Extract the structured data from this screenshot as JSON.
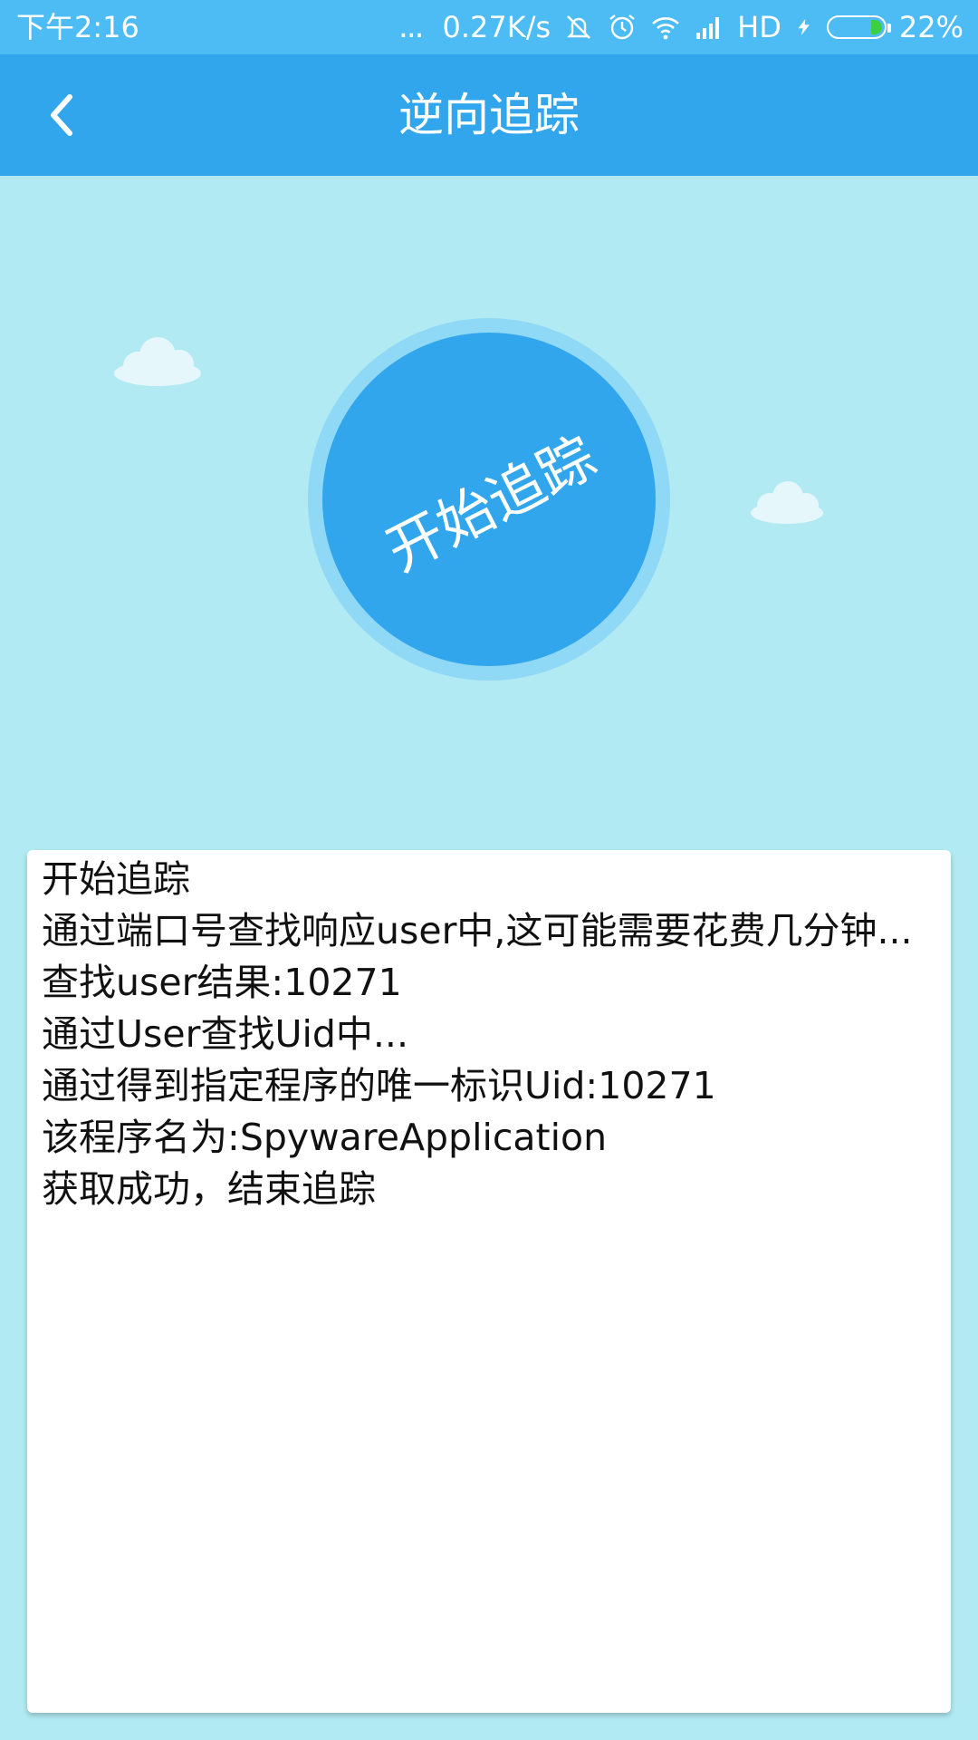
{
  "status_bar": {
    "time": "下午2:16",
    "more_indicator": "...",
    "network_speed": "0.27K/s",
    "icons": [
      "mute-icon",
      "alarm-icon",
      "wifi-icon",
      "signal-icon",
      "charging-icon",
      "battery-icon"
    ],
    "network_type": "HD",
    "battery_percent": "22%",
    "battery_level": 0.22,
    "battery_color": "#3cd040"
  },
  "app_bar": {
    "back_icon": "chevron-left-icon",
    "title": "逆向追踪"
  },
  "main": {
    "start_button_label": "开始追踪"
  },
  "log": {
    "lines": [
      "开始追踪",
      "通过端口号查找响应user中,这可能需要花费几分钟...",
      "查找user结果:10271",
      "通过User查找Uid中...",
      "通过得到指定程序的唯一标识Uid:10271",
      "该程序名为:SpywareApplication",
      "获取成功，结束追踪"
    ]
  },
  "colors": {
    "status_bar": "#4ebcf4",
    "app_bar": "#31a6ec",
    "background": "#b2eaf3",
    "button": "#31a6ec",
    "button_ring": "#8fd8f6"
  }
}
